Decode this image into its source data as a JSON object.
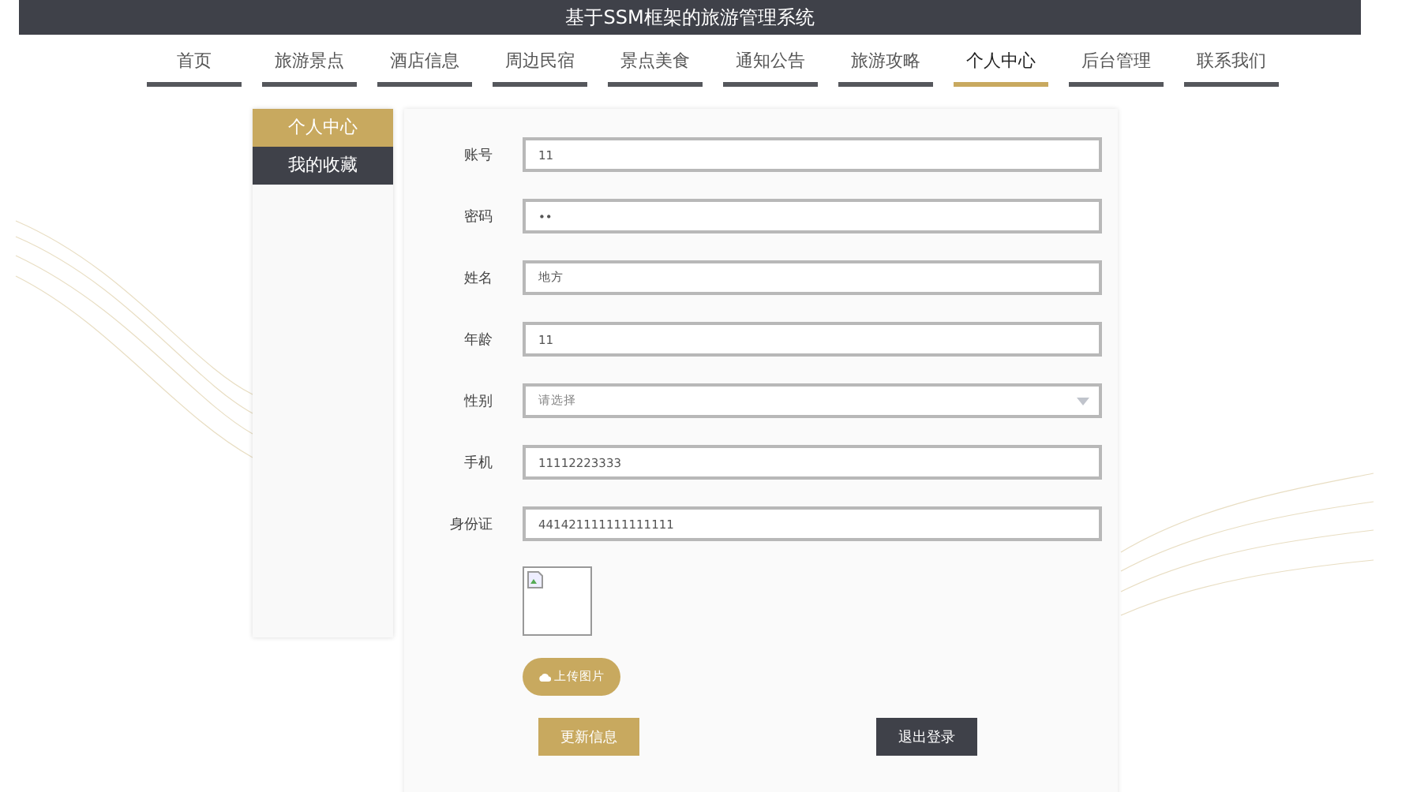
{
  "header": {
    "title": "基于SSM框架的旅游管理系统"
  },
  "nav": [
    {
      "label": "首页",
      "selected": false
    },
    {
      "label": "旅游景点",
      "selected": false
    },
    {
      "label": "酒店信息",
      "selected": false
    },
    {
      "label": "周边民宿",
      "selected": false
    },
    {
      "label": "景点美食",
      "selected": false
    },
    {
      "label": "通知公告",
      "selected": false
    },
    {
      "label": "旅游攻略",
      "selected": false
    },
    {
      "label": "个人中心",
      "selected": true
    },
    {
      "label": "后台管理",
      "selected": false
    },
    {
      "label": "联系我们",
      "selected": false
    }
  ],
  "sidebar": {
    "items": [
      {
        "label": "个人中心",
        "selected": true
      },
      {
        "label": "我的收藏",
        "selected": false
      }
    ]
  },
  "form": {
    "fields": [
      {
        "kind": "text",
        "label": "账号",
        "value": "11"
      },
      {
        "kind": "text",
        "label": "密码",
        "value": "••"
      },
      {
        "kind": "text",
        "label": "姓名",
        "value": "地方"
      },
      {
        "kind": "text",
        "label": "年龄",
        "value": "11"
      },
      {
        "kind": "select",
        "label": "性别",
        "placeholder": "请选择"
      },
      {
        "kind": "text",
        "label": "手机",
        "value": "11112223333"
      },
      {
        "kind": "text",
        "label": "身份证",
        "value": "441421111111111111"
      }
    ],
    "upload_button": "上传图片",
    "update_button": "更新信息",
    "logout_button": "退出登录"
  }
}
